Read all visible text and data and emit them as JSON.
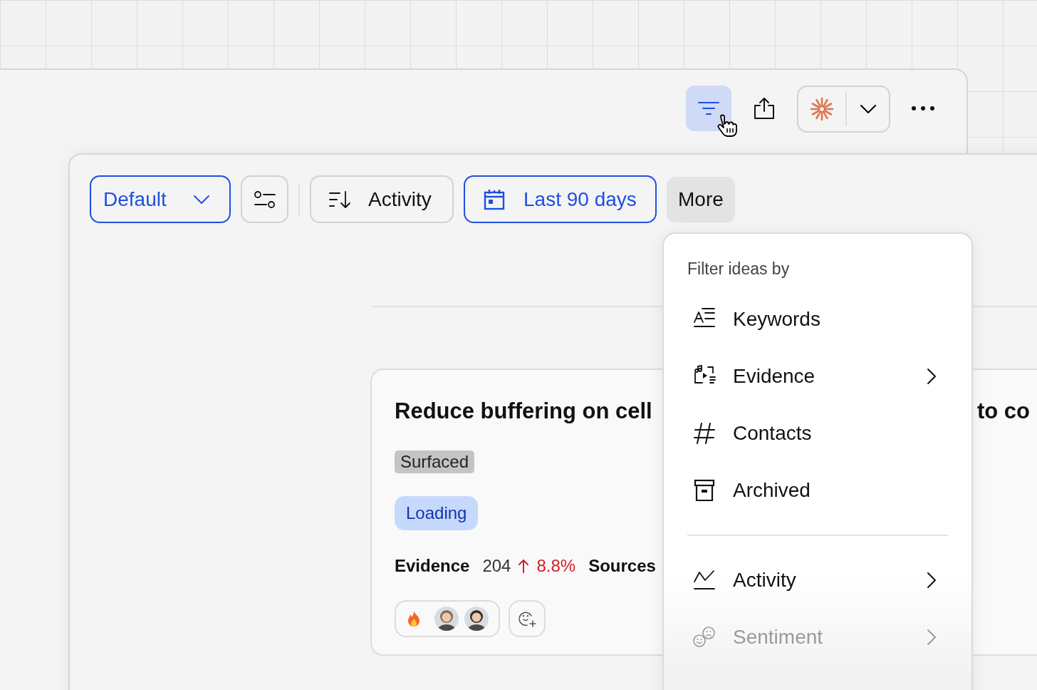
{
  "toolbar": {
    "buttons": [
      {
        "kind": "filter",
        "selected": true
      },
      {
        "kind": "share",
        "selected": false
      },
      {
        "kind": "assistant",
        "selected": false
      },
      {
        "kind": "more",
        "selected": false
      }
    ]
  },
  "filter_bar": {
    "items": [
      {
        "kind": "dropdown",
        "label": "Default",
        "active": true
      },
      {
        "kind": "view-settings",
        "active": false
      },
      {
        "kind": "sort",
        "label": "Activity",
        "active": false
      },
      {
        "kind": "date",
        "label": "Last 90 days",
        "active": true
      },
      {
        "kind": "more",
        "label": "More",
        "open": true
      }
    ]
  },
  "menu": {
    "heading": "Filter ideas by",
    "sections": [
      [
        {
          "kind": "keywords",
          "label": "Keywords",
          "submenu": false,
          "faded": false
        },
        {
          "kind": "evidence",
          "label": "Evidence",
          "submenu": true,
          "faded": false
        },
        {
          "kind": "contacts",
          "label": "Contacts",
          "submenu": false,
          "faded": false
        },
        {
          "kind": "archived",
          "label": "Archived",
          "submenu": false,
          "faded": false
        }
      ],
      [
        {
          "kind": "activity",
          "label": "Activity",
          "submenu": true,
          "faded": false
        },
        {
          "kind": "sentiment",
          "label": "Sentiment",
          "submenu": true,
          "faded": true
        }
      ]
    ]
  },
  "cards": [
    {
      "title": "Reduce buffering on cell",
      "status": "Surfaced",
      "tag": "Loading",
      "evidence_label": "Evidence",
      "evidence_count": "204",
      "rising": true,
      "change": "8.8%",
      "sources_label": "Sources"
    },
    {
      "title": "to co"
    }
  ]
}
